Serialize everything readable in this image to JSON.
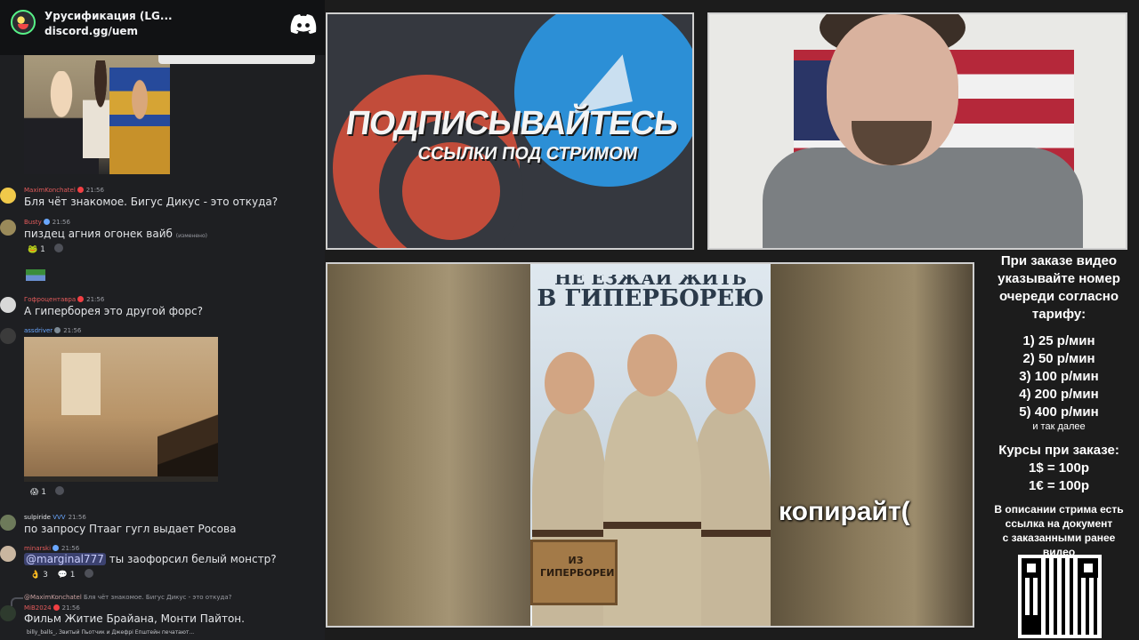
{
  "discord": {
    "server_name": "Урусификация (LG...",
    "invite": "discord.gg/uem"
  },
  "chat": {
    "messages": [
      {
        "author": "MaximKonchatel",
        "author_color": "#e35b5b",
        "time": "21:56",
        "text": "Бля чёт знакомое. Бигус Дикус - это откуда?"
      },
      {
        "author": "Busty",
        "author_color": "#e35b5b",
        "time": "21:56",
        "text": "пиздец агния огонек вайб",
        "edited": "(изменено)",
        "reaction_count": "1"
      },
      {
        "author": "Гофроцентавра",
        "author_color": "#e35b5b",
        "time": "21:56",
        "text": "А гиперборея это другой форс?"
      },
      {
        "author": "assdriver",
        "author_color": "#6aa7ff",
        "time": "21:56",
        "reaction_count": "1"
      },
      {
        "author": "sulpiride",
        "author_color": "#e3e5e8",
        "author_suffix": "VVV",
        "time": "21:56",
        "text": "по запросу Птааг гугл выдает Росова"
      },
      {
        "author": "minarski",
        "author_color": "#e35b5b",
        "time": "21:56",
        "mention": "@marginal777",
        "text": "ты заофорсил белый монстр?",
        "reaction_counts": [
          "3",
          "1"
        ]
      },
      {
        "author": "MiB2024",
        "author_color": "#e35b5b",
        "time": "21:56",
        "text": "Фильм Житие Брайана, Монти Пайтон.",
        "reply_author": "@MaximKonchatel",
        "reply_text": "Бля чёт знакомое. Бигус Дикус - это откуда?"
      }
    ],
    "typing": "billy_balls_, Звитый Пьотчик и Джефрі Епштейн печатают..."
  },
  "banner": {
    "title": "ПОДПИСЫВАЙТЕСЬ",
    "subtitle": "ССЫЛКИ ПОД СТРИМОМ"
  },
  "video": {
    "poster_title_cut": "НЕ ЕЗЖАЙ ЖИТЬ",
    "poster_title": "В ГИПЕРБОРЕЮ",
    "crate_label": "ИЗ ГИПЕРБОРЕИ",
    "caption": "копирайт("
  },
  "price_panel": {
    "heading": [
      "При заказе видео",
      "указывайте номер",
      "очереди согласно",
      "тарифу:"
    ],
    "tiers": [
      "1) 25 р/мин",
      "2) 50 р/мин",
      "3) 100 р/мин",
      "4) 200 р/мин",
      "5) 400 р/мин"
    ],
    "etc": "и так далее",
    "courses_title": "Курсы при заказе:",
    "rates": [
      "1$ = 100р",
      "1€ = 100р"
    ],
    "description": [
      "В описании стрима есть",
      "ссылка на документ",
      "с заказанными ранее",
      "видео"
    ]
  },
  "colors": {
    "discord_blurple": "#5865f2",
    "patreon_red": "#c24c3a",
    "telegram_blue": "#2c8fd6"
  },
  "icons": [
    "discord-logo-icon",
    "qr-code-icon",
    "telegram-plane-icon",
    "patreon-icon"
  ]
}
